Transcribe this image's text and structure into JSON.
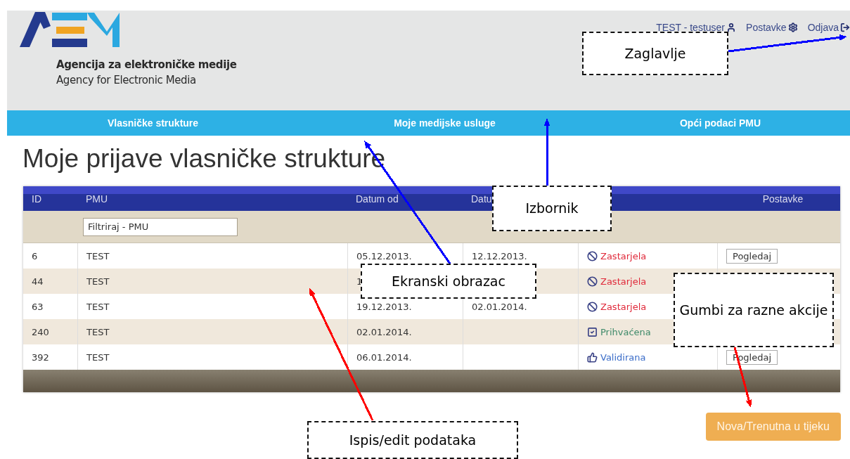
{
  "header": {
    "agency_name": "Agencija za elektroničke medije",
    "agency_name_en": "Agency for Electronic Media",
    "user_links": [
      {
        "kind": "user",
        "label": "TEST - testuser"
      },
      {
        "kind": "settings",
        "label": "Postavke"
      },
      {
        "kind": "logout",
        "label": "Odjava"
      }
    ]
  },
  "nav": [
    {
      "label": "Vlasničke strukture"
    },
    {
      "label": "Moje medijske usluge"
    },
    {
      "label": "Opći podaci PMU"
    }
  ],
  "page_title": "Moje prijave vlasničke strukture",
  "table": {
    "columns": [
      "ID",
      "PMU",
      "Datum od",
      "Datu",
      "",
      "Postavke"
    ],
    "filter": {
      "placeholder": "Filtriraj - PMU"
    },
    "rows": [
      {
        "id": "6",
        "pmu": "TEST",
        "date_from": "05.12.2013.",
        "date_to": "12.12.2013.",
        "status": {
          "kind": "expired",
          "label": "Zastarjela"
        },
        "button": "Pogledaj"
      },
      {
        "id": "44",
        "pmu": "TEST",
        "date_from": "1",
        "date_to": "",
        "status": {
          "kind": "expired",
          "label": "Zastarjela"
        },
        "button": ""
      },
      {
        "id": "63",
        "pmu": "TEST",
        "date_from": "19.12.2013.",
        "date_to": "02.01.2014.",
        "status": {
          "kind": "expired",
          "label": "Zastarjela"
        },
        "button": ""
      },
      {
        "id": "240",
        "pmu": "TEST",
        "date_from": "02.01.2014.",
        "date_to": "",
        "status": {
          "kind": "accepted",
          "label": "Prihvaćena"
        },
        "button": ""
      },
      {
        "id": "392",
        "pmu": "TEST",
        "date_from": "06.01.2014.",
        "date_to": "",
        "status": {
          "kind": "validated",
          "label": "Validirana"
        },
        "button": "Pogledaj"
      }
    ]
  },
  "action_button": "Nova/Trenutna u tijeku",
  "callouts": [
    {
      "label": "Zaglavlje",
      "color": "#0000ff"
    },
    {
      "label": "Izbornik",
      "color": "#0000ff"
    },
    {
      "label": "Ekranski obrazac",
      "color": "#0000ff"
    },
    {
      "label": "Gumbi za razne akcije",
      "color": "#ff0000"
    },
    {
      "label": "Ispis/edit podataka",
      "color": "#ff0000"
    }
  ]
}
